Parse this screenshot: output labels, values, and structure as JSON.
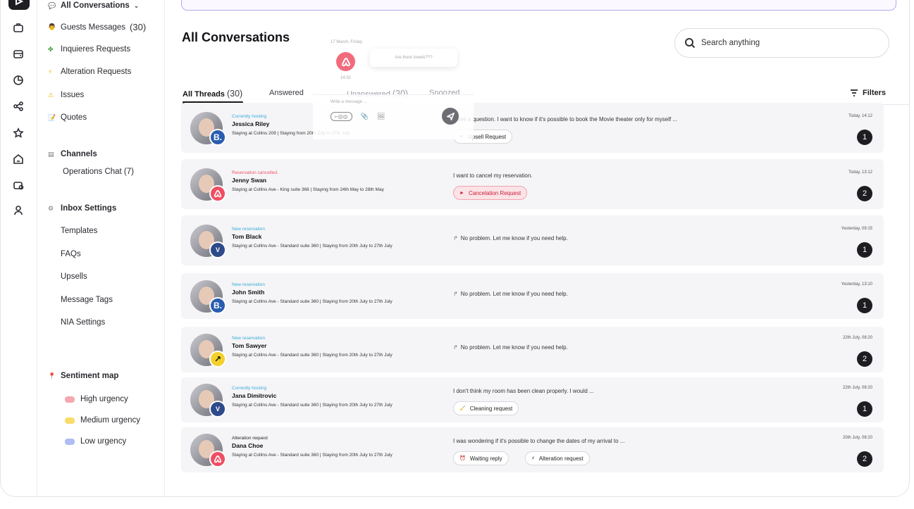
{
  "nav": {
    "all_conversations": "All Conversations",
    "items": [
      {
        "label": "Guests Messages",
        "count": "(30)"
      },
      {
        "label": "Inquieres Requests"
      },
      {
        "label": "Alteration Requests"
      },
      {
        "label": "Issues"
      },
      {
        "label": "Quotes"
      }
    ],
    "channels_title": "Channels",
    "operations_chat": "Operations Chat (7)",
    "inbox_settings_title": "Inbox Settings",
    "settings": [
      "Templates",
      "FAQs",
      "Upsells",
      "Message Tags",
      "NIA Settings"
    ],
    "sentiment_title": "Sentiment map",
    "sentiment": [
      {
        "label": "High urgency",
        "color": "#f6a7b0"
      },
      {
        "label": "Medium urgency",
        "color": "#f9dc6a"
      },
      {
        "label": "Low urgency",
        "color": "#aebdf4"
      }
    ]
  },
  "main": {
    "title": "All Conversations",
    "search_placeholder": "Search anything",
    "tabs": [
      {
        "label": "All Threads",
        "count": "(30)"
      },
      {
        "label": "Answered"
      },
      {
        "label": "Unanswered",
        "count": "(30)"
      },
      {
        "label": "Snoozed"
      }
    ],
    "filters_label": "Filters"
  },
  "preview": {
    "date": "17 March, Friday",
    "message": "Are there towels???",
    "time": "14:32",
    "compose_placeholder": "Write a message ..."
  },
  "conversations": [
    {
      "status": "Currently hosting",
      "status_type": "hosting",
      "name": "Jessica Riley",
      "stay": "Staying at Collins 209 |  Staying from 20th July to 27th July",
      "message": "Have a question. I want to know if it's possible to book the Movie theater only for myself ...",
      "tags": [
        {
          "label": "Upsell Request",
          "icon": "✂"
        }
      ],
      "time": "Today, 14:12",
      "count": "1",
      "channel": "booking"
    },
    {
      "status": "Reservation cancelled.",
      "status_type": "cancel",
      "name": "Jenny Swan",
      "stay": "Staying at Collins Ave - King suite 368 |  Staying from 24th May to 28th May",
      "message": "I want to cancel my reservation.",
      "tags": [
        {
          "label": "Cancelation Request",
          "icon": "►",
          "style": "red"
        }
      ],
      "time": "Today, 13:12",
      "count": "2",
      "channel": "airbnb"
    },
    {
      "status": "New reservation",
      "status_type": "new",
      "name": "Tom Black",
      "stay": "Staying at Collins Ave - Standard suite 360 |  Staying from 20th July to 27th July",
      "message": "No problem. Let me know if you need help.",
      "reply": true,
      "tags": [],
      "time": "Yesterday, 09:15",
      "count": "1",
      "channel": "vrbo"
    },
    {
      "status": "New reservation",
      "status_type": "new",
      "name": "John Smith",
      "stay": "Staying at Collins Ave - Standard suite 360 |  Staying from 20th July to 27th July",
      "message": "No problem. Let me know if you need help.",
      "reply": true,
      "tags": [],
      "time": "Yesterday, 13:10",
      "count": "1",
      "channel": "booking"
    },
    {
      "status": "New reservation",
      "status_type": "new",
      "name": "Tom Sawyer",
      "stay": "Staying at Collins Ave - Standard suite 360 |  Staying from 20th July to 27th July",
      "message": "No problem. Let me know if you need help.",
      "reply": true,
      "tags": [],
      "time": "22th July, 08:20",
      "count": "2",
      "channel": "direct"
    },
    {
      "status": "Currently hosting",
      "status_type": "hosting",
      "name": "Jana Dimitrovic",
      "stay": "Staying at Collins Ave - Standard suite 360 |  Staying from 20th July to 27th July",
      "message": "I don't think my room has been clean properly. I would ...",
      "tags": [
        {
          "label": "Cleaning request",
          "icon": "🧹"
        }
      ],
      "time": "22th July, 08:20",
      "count": "1",
      "channel": "vrbo"
    },
    {
      "status": "Alteration request",
      "status_type": "alter",
      "name": "Dana Choe",
      "stay": "Staying at Collins Ave - Standard suite 360 |  Staying from 20th July to 27th July",
      "message": "I was wondering if it's possible to change the dates of my arrival to ...",
      "tags": [
        {
          "label": "Waiting reply",
          "icon": "⏰"
        },
        {
          "label": "Alteration request",
          "icon": "⚡"
        }
      ],
      "time": "20th July, 08:20",
      "count": "2",
      "channel": "airbnb"
    }
  ]
}
